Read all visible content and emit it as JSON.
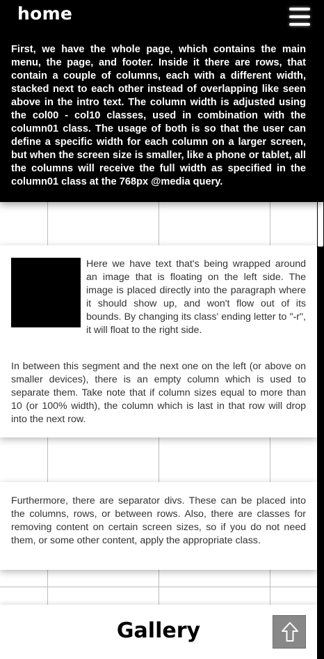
{
  "header": {
    "title": "home",
    "menu_icon": "hamburger-menu-icon"
  },
  "intro": {
    "text": "First, we have the whole page, which contains the main menu, the page, and footer. Inside it there are rows, that contain a couple of columns, each with a different width, stacked next to each other instead of overlapping like seen above in the intro text. The column width is adjusted using the col00 - col10 classes, used in combination with the column01 class. The usage of both is so that the user can define a specific width for each column on a larger screen, but when the screen size is smaller, like a phone or tablet, all the columns will receive the full width as specified in the column01 class at the 768px @media query."
  },
  "segment_1": {
    "paragraph_1": "Here we have text that's being wrapped around an image that is floating on the left side. The image is placed directly into the paragraph where it should show up, and won't flow out of its bounds. By changing its class' ending letter to \"-r\", it will float to the right side.",
    "paragraph_2": "In between this segment and the next one on the left (or above on smaller devices), there is an empty column which is used to separate them. Take note that if column sizes equal to more than 10 (or 100% width), the column which is last in that row will drop into the next row."
  },
  "segment_2": {
    "paragraph": "Furthermore, there are separator divs. These can be placed into the columns, rows, or between rows. Also, there are classes for removing content on certain screen sizes, so if you do not need them, or some other content, apply the appropriate class."
  },
  "footer": {
    "title": "Gallery",
    "back_to_top_icon": "arrow-up-icon"
  },
  "colors": {
    "header_bg": "#000000",
    "page_bg": "#ffffff",
    "grid_line": "#bdbdbd",
    "back_to_top_bg": "#888888"
  }
}
